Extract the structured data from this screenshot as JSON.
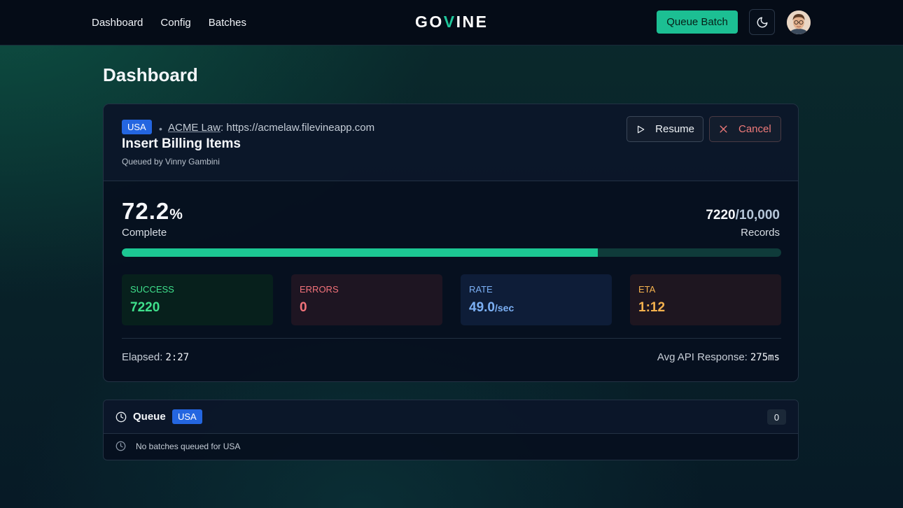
{
  "nav": {
    "links": [
      "Dashboard",
      "Config",
      "Batches"
    ],
    "logo_pre": "GO",
    "logo_v": "V",
    "logo_post": "INE",
    "queue_batch_label": "Queue Batch"
  },
  "page": {
    "title": "Dashboard"
  },
  "batch": {
    "region": "USA",
    "separator": "•",
    "firm_name": "ACME Law",
    "firm_url": ": https://acmelaw.filevineapp.com",
    "title": "Insert Billing Items",
    "queued_by": "Queued by Vinny Gambini",
    "resume_label": "Resume",
    "cancel_label": "Cancel",
    "percent": "72.2",
    "percent_symbol": "%",
    "progress_fraction": 0.722,
    "complete_label": "Complete",
    "records_done": "7220",
    "records_total": "/10,000",
    "records_label": "Records",
    "stats": {
      "success_label": "SUCCESS",
      "success_value": "7220",
      "errors_label": "ERRORS",
      "errors_value": "0",
      "rate_label": "RATE",
      "rate_value": "49.0",
      "rate_unit": "/sec",
      "eta_label": "ETA",
      "eta_value": "1:12"
    },
    "elapsed_label": "Elapsed:",
    "elapsed_value": "2:27",
    "avg_api_label": "Avg API Response:",
    "avg_api_value": "275ms"
  },
  "queue": {
    "title": "Queue",
    "region": "USA",
    "count": "0",
    "empty_message": "No batches queued for USA"
  },
  "colors": {
    "accent": "#1cbf93",
    "success": "#3fe08c",
    "error": "#f2727a",
    "rate": "#7cb0f4",
    "eta": "#f5b24e",
    "badge": "#2466e0"
  },
  "icons": [
    "moon-icon",
    "play-icon",
    "x-icon",
    "clock-icon"
  ]
}
